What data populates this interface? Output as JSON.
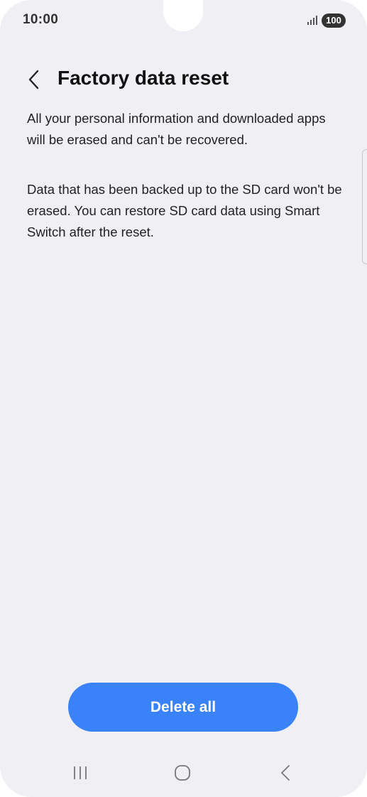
{
  "status_bar": {
    "time": "10:00",
    "battery": "100",
    "signal_icon": "signal-icon"
  },
  "header": {
    "back_icon": "chevron-left-icon",
    "title": "Factory data reset"
  },
  "content": {
    "paragraph_1": "All your personal information and downloaded apps will be erased and can't be recovered.",
    "paragraph_2": "Data that has been backed up to the SD card won't be erased. You can restore SD card data using Smart Switch after the reset."
  },
  "actions": {
    "delete_all_label": "Delete all"
  },
  "nav_bar": {
    "recents_icon": "recents-icon",
    "home_icon": "home-icon",
    "back_icon": "back-icon"
  },
  "colors": {
    "background": "#f0f0f4",
    "accent": "#3a82f7",
    "text": "#111111"
  }
}
